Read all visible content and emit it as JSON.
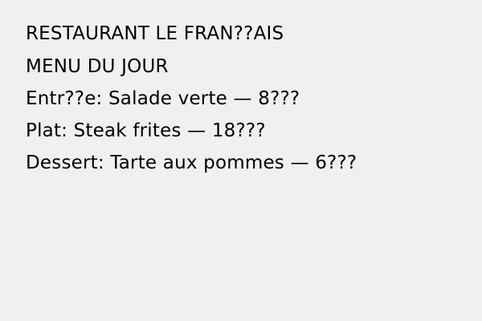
{
  "menu": {
    "restaurant_name": "RESTAURANT LE FRAN??AIS",
    "menu_title": "MENU DU JOUR",
    "items": [
      {
        "text": "Entr??e: Salade verte — 8???"
      },
      {
        "text": "Plat: Steak frites — 18???"
      },
      {
        "text": "Dessert: Tarte aux pommes — 6???"
      }
    ]
  },
  "colors": {
    "background": "#f0f0f0",
    "text": "#000000"
  }
}
